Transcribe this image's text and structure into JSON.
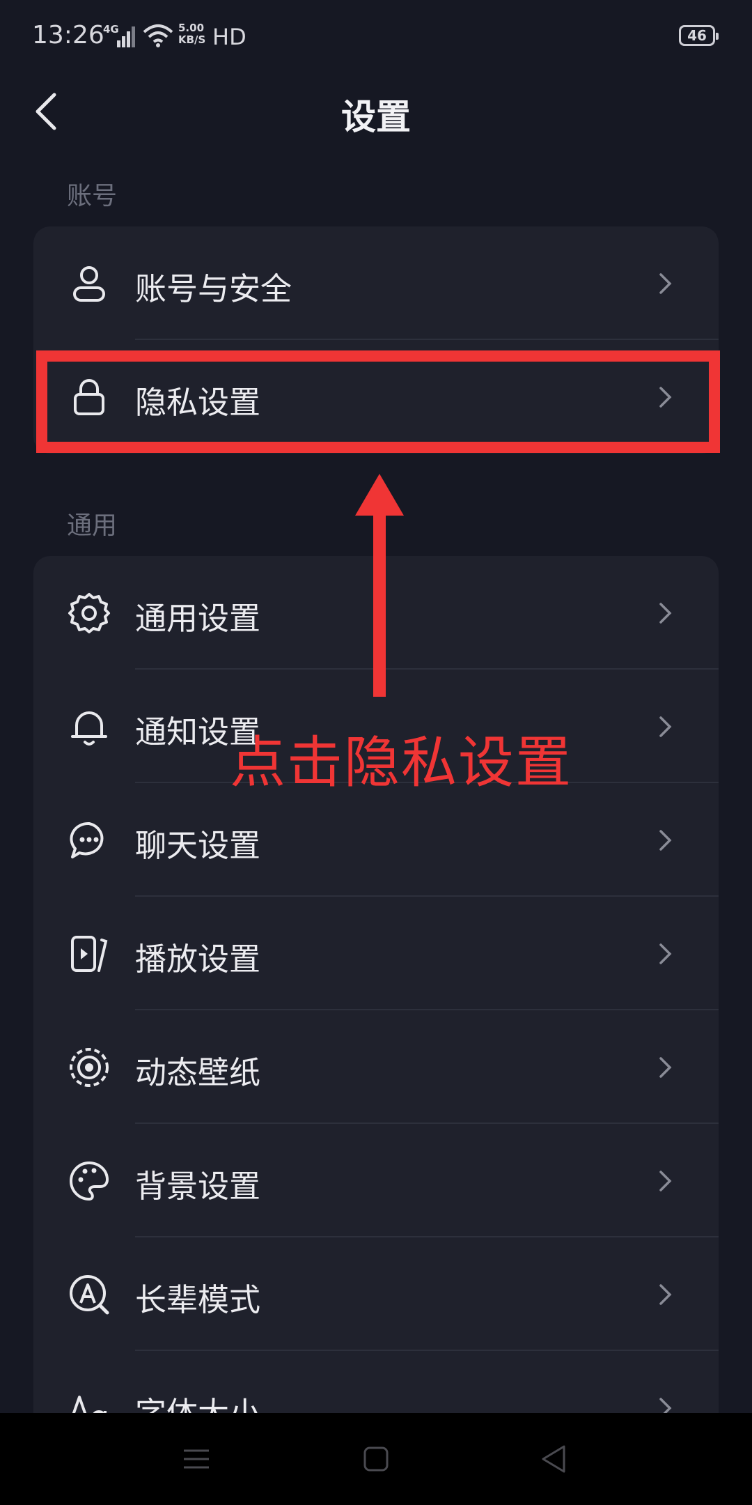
{
  "status_bar": {
    "time": "13:26",
    "network": "4G",
    "speed_value": "5.00",
    "speed_unit": "KB/S",
    "hd": "HD",
    "battery": "46"
  },
  "header": {
    "title": "设置"
  },
  "sections": {
    "account": {
      "title": "账号",
      "items": [
        {
          "label": "账号与安全",
          "icon": "user-icon"
        },
        {
          "label": "隐私设置",
          "icon": "lock-icon"
        }
      ]
    },
    "general": {
      "title": "通用",
      "items": [
        {
          "label": "通用设置",
          "icon": "gear-icon"
        },
        {
          "label": "通知设置",
          "icon": "bell-icon"
        },
        {
          "label": "聊天设置",
          "icon": "chat-bubble-icon"
        },
        {
          "label": "播放设置",
          "icon": "play-icon"
        },
        {
          "label": "动态壁纸",
          "icon": "dynamic-wallpaper-icon"
        },
        {
          "label": "背景设置",
          "icon": "palette-icon"
        },
        {
          "label": "长辈模式",
          "icon": "elder-mode-icon"
        },
        {
          "label": "字体大小",
          "icon": "font-size-icon"
        }
      ]
    }
  },
  "annotation": {
    "text": "点击隐私设置",
    "color": "#f03535"
  },
  "colors": {
    "background": "#161823",
    "card": "#1f212c",
    "annotation": "#f03535"
  }
}
